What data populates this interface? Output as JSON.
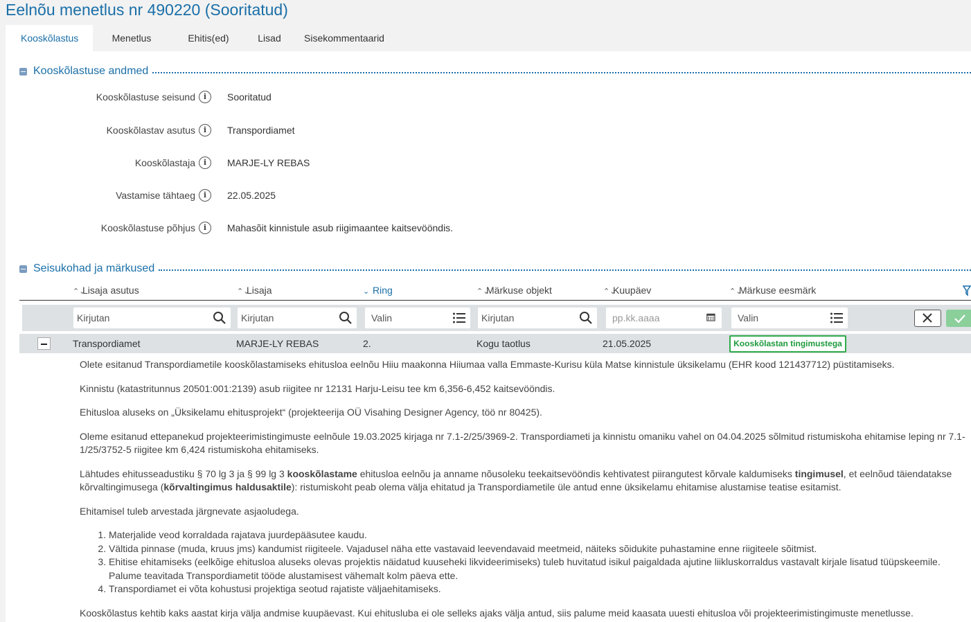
{
  "page": {
    "title": "Eelnõu menetlus nr 490220 (Sooritatud)"
  },
  "tabs": [
    {
      "label": "Kooskõlastus",
      "active": true
    },
    {
      "label": "Menetlus"
    },
    {
      "label": "Ehitis(ed)"
    },
    {
      "label": "Lisad"
    },
    {
      "label": "Sisekommentaarid"
    }
  ],
  "section1": {
    "title": "Kooskõlastuse andmed",
    "fields": [
      {
        "label": "Kooskõlastuse seisund",
        "value": "Sooritatud"
      },
      {
        "label": "Kooskõlastav asutus",
        "value": "Transpordiamet"
      },
      {
        "label": "Kooskõlastaja",
        "value": "MARJE-LY REBAS"
      },
      {
        "label": "Vastamise tähtaeg",
        "value": "22.05.2025"
      },
      {
        "label": "Kooskõlastuse põhjus",
        "value": "Mahasõit kinnistule asub riigimaantee kaitsevööndis."
      }
    ]
  },
  "section2": {
    "title": "Seisukohad ja märkused",
    "columns": [
      "Lisaja asutus",
      "Lisaja",
      "Ring",
      "Märkuse objekt",
      "Kuupäev",
      "Märkuse eesmärk"
    ],
    "filters": {
      "lisaja_asutus": "Kirjutan",
      "lisaja": "Kirjutan",
      "ring": "Valin",
      "objekt": "Kirjutan",
      "kuupaev": "pp.kk.aaaa",
      "eesmark": "Valin"
    },
    "row": {
      "lisaja_asutus": "Transpordiamet",
      "lisaja": "MARJE-LY REBAS",
      "ring": "2.",
      "objekt": "Kogu taotlus",
      "kuupaev": "21.05.2025",
      "eesmark": "Kooskõlastan tingimustega"
    },
    "text": {
      "p1": "Olete esitanud Transpordiametile kooskõlastamiseks ehitusloa eelnõu Hiiu maakonna Hiiumaa valla Emmaste-Kurisu küla Matse kinnistule üksikelamu (EHR kood 121437712) püstitamiseks.",
      "p2": "Kinnistu (katastritunnus 20501:001:2139) asub riigitee nr 12131 Harju-Leisu tee km 6,356-6,452 kaitsevööndis.",
      "p3": "Ehitusloa aluseks on „Üksikelamu ehitusprojekt“ (projekteerija OÜ Visahing Designer Agency, töö nr 80425).",
      "p4": "Oleme esitanud ettepanekud projekteerimistingimuste eelnõule 19.03.2025 kirjaga nr 7.1-2/25/3969-2. Transpordiameti ja kinnistu omaniku vahel on 04.04.2025 sõlmitud ristumiskoha ehitamise leping nr 7.1-1/25/3752-5 riigitee km 6,424 ristumiskoha ehitamiseks.",
      "p5a": "Lähtudes ehitusseadustiku § 70 lg 3 ja § 99 lg 3 ",
      "p5b": "kooskõlastame",
      "p5c": " ehitusloa eelnõu ja anname nõusoleku teekaitsevööndis kehtivatest piirangutest kõrvale kaldumiseks ",
      "p5d": "tingimusel",
      "p5e": ", et eelnõud täiendatakse kõrvaltingimusega (",
      "p5f": "kõrvaltingimus haldusaktile",
      "p5g": "): ristumiskoht peab olema välja ehitatud ja Transpordiametile üle antud enne üksikelamu ehitamise alustamise teatise esitamist.",
      "p6": "Ehitamisel tuleb arvestada järgnevate asjaoludega.",
      "list": [
        "Materjalide veod korraldada rajatava juurdepääsutee kaudu.",
        "Vältida pinnase (muda, kruus jms) kandumist riigiteele. Vajadusel näha ette vastavaid leevendavaid meetmeid, näiteks sõidukite puhastamine enne riigiteele sõitmist.",
        "Ehitise ehitamiseks (eelkõige ehitusloa aluseks olevas projektis näidatud kuuseheki likvideerimiseks) tuleb huvitatud isikul paigaldada ajutine liikluskorraldus vastavalt kirjale lisatud tüüpskeemile. Palume teavitada Transpordiametit tööde alustamisest vähemalt kolm päeva ette.",
        "Transpordiamet ei võta kohustusi projektiga seotud rajatiste väljaehitamiseks."
      ],
      "p7": "Kooskõlastus kehtib kaks aastat kirja välja andmise kuupäevast. Kui ehitusluba ei ole selleks ajaks välja antud, siis palume meid kaasata uuesti ehitusloa või projekteerimistingimuste menetlusse."
    }
  }
}
